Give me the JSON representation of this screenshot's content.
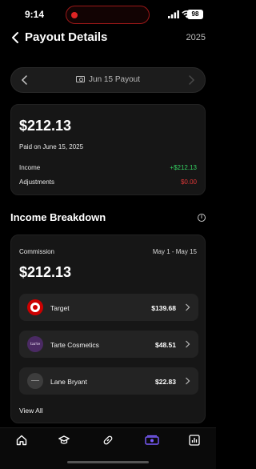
{
  "status_bar": {
    "time": "9:14",
    "battery": "98"
  },
  "header": {
    "title": "Payout Details",
    "year": "2025"
  },
  "payout_selector": {
    "label": "Jun 15 Payout"
  },
  "summary": {
    "amount": "$212.13",
    "paid_on": "Paid on June 15, 2025",
    "rows": [
      {
        "label": "Income",
        "value": "+$212.13",
        "tone": "positive"
      },
      {
        "label": "Adjustments",
        "value": "$0.00",
        "tone": "negative"
      }
    ]
  },
  "breakdown": {
    "title": "Income Breakdown",
    "commission_label": "Commission",
    "date_range": "May 1 - May 15",
    "amount": "$212.13",
    "brands": [
      {
        "name": "Target",
        "amount": "$139.68",
        "logo_text": ""
      },
      {
        "name": "Tarte Cosmetics",
        "amount": "$48.51",
        "logo_text": "tarte"
      },
      {
        "name": "Lane Bryant",
        "amount": "$22.83",
        "logo_text": ""
      }
    ],
    "view_all": "View All"
  },
  "nav": {
    "items": [
      "home-icon",
      "graduation-cap-icon",
      "link-icon",
      "payout-icon",
      "analytics-icon"
    ],
    "active": "payout-icon"
  },
  "colors": {
    "positive": "#35d162",
    "negative": "#e23838",
    "accent": "#7b5cff"
  }
}
